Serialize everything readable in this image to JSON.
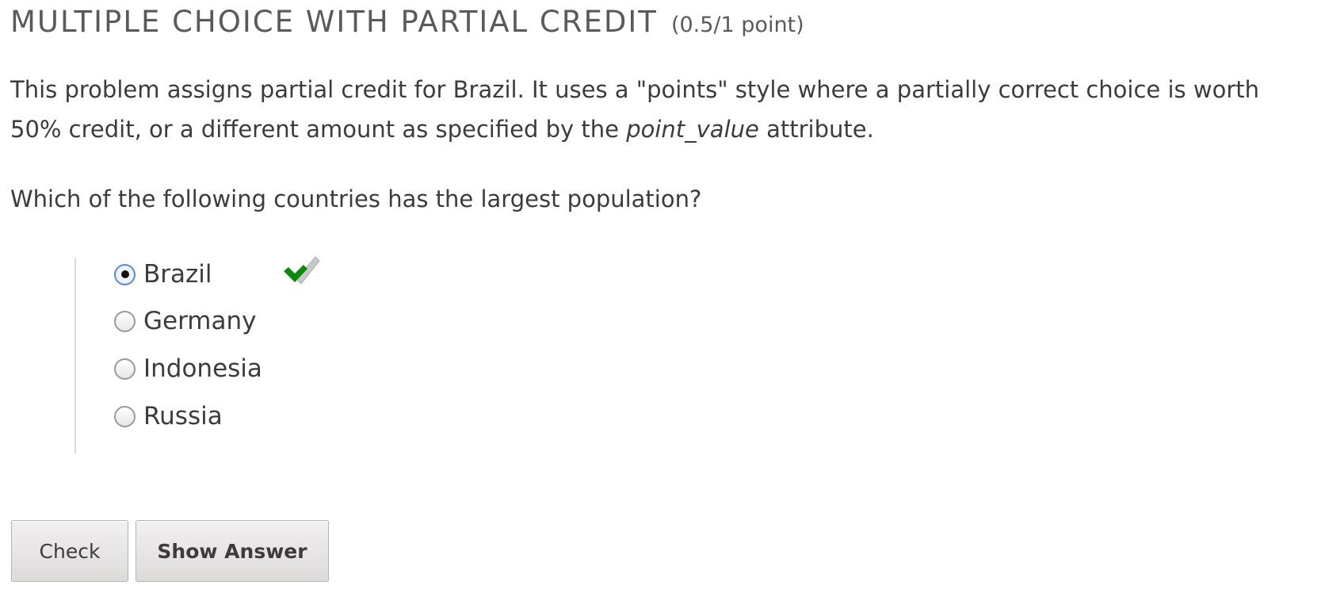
{
  "problem": {
    "title": "MULTIPLE CHOICE WITH PARTIAL CREDIT",
    "score": "(0.5/1 point)",
    "description_before": "This problem assigns partial credit for Brazil. It uses a \"points\" style where a partially correct choice is worth 50% credit, or a different amount as specified by the ",
    "description_em": "point_value",
    "description_after": " attribute.",
    "question": "Which of the following countries has the largest population?"
  },
  "choices": [
    {
      "label": "Brazil",
      "selected": true,
      "status": "partially-correct"
    },
    {
      "label": "Germany",
      "selected": false
    },
    {
      "label": "Indonesia",
      "selected": false
    },
    {
      "label": "Russia",
      "selected": false
    }
  ],
  "status_icon": "partial-check-icon",
  "colors": {
    "check_green": "#0a8a0a",
    "check_grey": "#c8c8c8"
  },
  "buttons": {
    "check_label": "Check",
    "show_answer_label": "Show Answer"
  }
}
